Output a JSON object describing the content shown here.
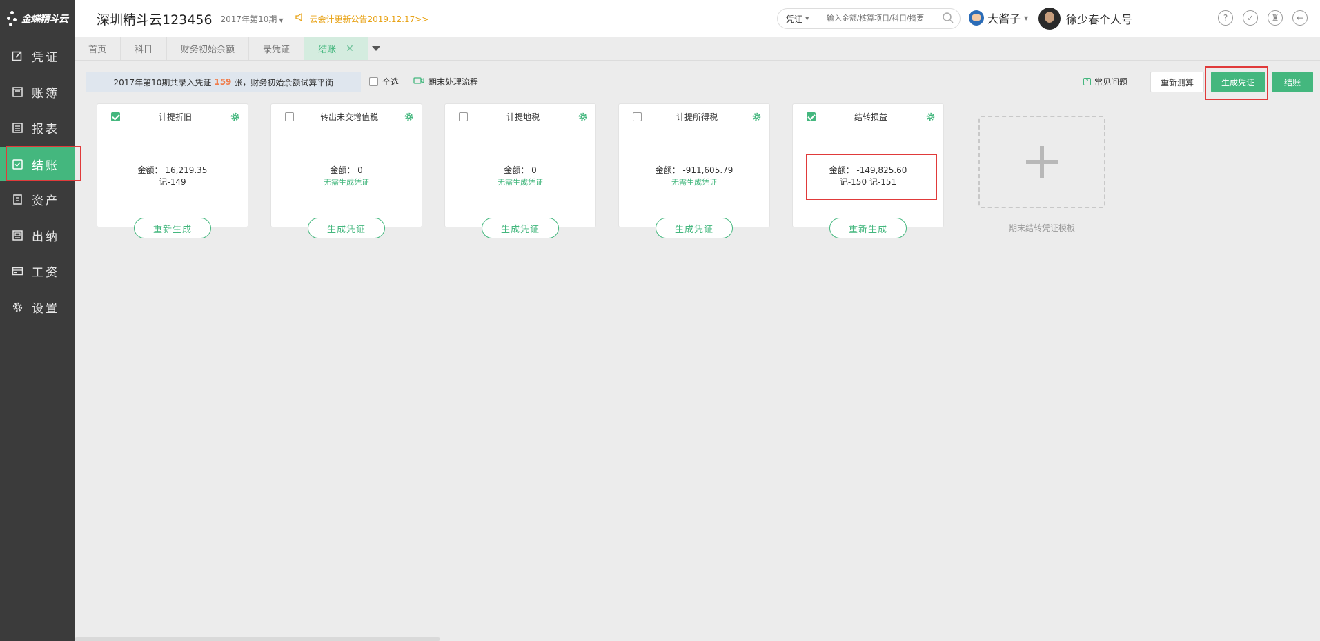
{
  "sidebar": {
    "logo_text": "金蝶精斗云",
    "items": [
      {
        "label": "凭证",
        "icon": "edit-icon"
      },
      {
        "label": "账簿",
        "icon": "ledger-icon"
      },
      {
        "label": "报表",
        "icon": "report-icon"
      },
      {
        "label": "结账",
        "icon": "checkout-icon",
        "active": true
      },
      {
        "label": "资产",
        "icon": "asset-icon"
      },
      {
        "label": "出纳",
        "icon": "cashier-icon"
      },
      {
        "label": "工资",
        "icon": "salary-icon"
      },
      {
        "label": "设置",
        "icon": "gear-icon"
      }
    ]
  },
  "header": {
    "company": "深圳精斗云123456",
    "period": "2017年第10期",
    "notice": "云会计更新公告2019.12.17>>",
    "search": {
      "type": "凭证",
      "placeholder": "输入金额/核算项目/科目/摘要"
    },
    "user1": "大酱子",
    "user2": "徐少春个人号"
  },
  "tabs": [
    {
      "label": "首页"
    },
    {
      "label": "科目"
    },
    {
      "label": "财务初始余额"
    },
    {
      "label": "录凭证"
    },
    {
      "label": "结账",
      "active": true,
      "closable": true
    }
  ],
  "toolbar": {
    "summary_prefix": "2017年第10期共录入凭证",
    "summary_count": "159",
    "summary_suffix": "张，财务初始余额试算平衡",
    "select_all": "全选",
    "flow": "期末处理流程",
    "faq": "常见问题",
    "recalc": "重新测算",
    "generate": "生成凭证",
    "close_account": "结账"
  },
  "cards": [
    {
      "title": "计提折旧",
      "checked": true,
      "amount": "金额： 16,219.35",
      "detail": "记-149",
      "note": "",
      "button": "重新生成"
    },
    {
      "title": "转出未交增值税",
      "checked": false,
      "amount": "金额： 0",
      "detail": "",
      "note": "无需生成凭证",
      "button": "生成凭证"
    },
    {
      "title": "计提地税",
      "checked": false,
      "amount": "金额： 0",
      "detail": "",
      "note": "无需生成凭证",
      "button": "生成凭证"
    },
    {
      "title": "计提所得税",
      "checked": false,
      "amount": "金额： -911,605.79",
      "detail": "",
      "note": "无需生成凭证",
      "button": "生成凭证"
    },
    {
      "title": "结转损益",
      "checked": true,
      "amount": "金额： -149,825.60",
      "detail": "记-150 记-151",
      "note": "",
      "button": "重新生成"
    }
  ],
  "template_label": "期末结转凭证模板",
  "colors": {
    "accent": "#44b77e",
    "highlight": "#e03a3a",
    "count": "#f07c4a",
    "notice": "#e8a317",
    "sidebar": "#3b3b3b"
  }
}
